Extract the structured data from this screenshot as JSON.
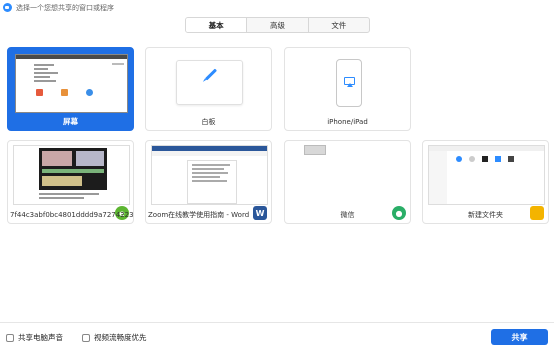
{
  "window": {
    "title": "选择一个您想共享的窗口或程序"
  },
  "tabs": [
    {
      "label": "基本",
      "active": true
    },
    {
      "label": "高级",
      "active": false
    },
    {
      "label": "文件",
      "active": false
    }
  ],
  "cards": [
    {
      "label": "屏幕",
      "icon": "screen-preview",
      "selected": true
    },
    {
      "label": "白板",
      "icon": "pen-icon"
    },
    {
      "label": "iPhone/iPad",
      "icon": "airplay-icon"
    },
    {
      "label": "7f44c3abf0bc4801dddd9a7274223...",
      "icon": "browser-icon"
    },
    {
      "label": "Zoom在线教学使用指南 - Word",
      "icon": "word-icon"
    },
    {
      "label": "微信",
      "icon": "wechat-icon"
    },
    {
      "label": "新建文件夹",
      "icon": "folder-icon"
    }
  ],
  "options": {
    "share_audio": "共享电脑声音",
    "optimize_video": "视频流畅度优先"
  },
  "share_button": "共享",
  "colors": {
    "accent": "#1f6fe5",
    "word": "#2b579a",
    "wechat": "#2aae67",
    "browser": "#5cb531",
    "folder": "#f4b400"
  }
}
